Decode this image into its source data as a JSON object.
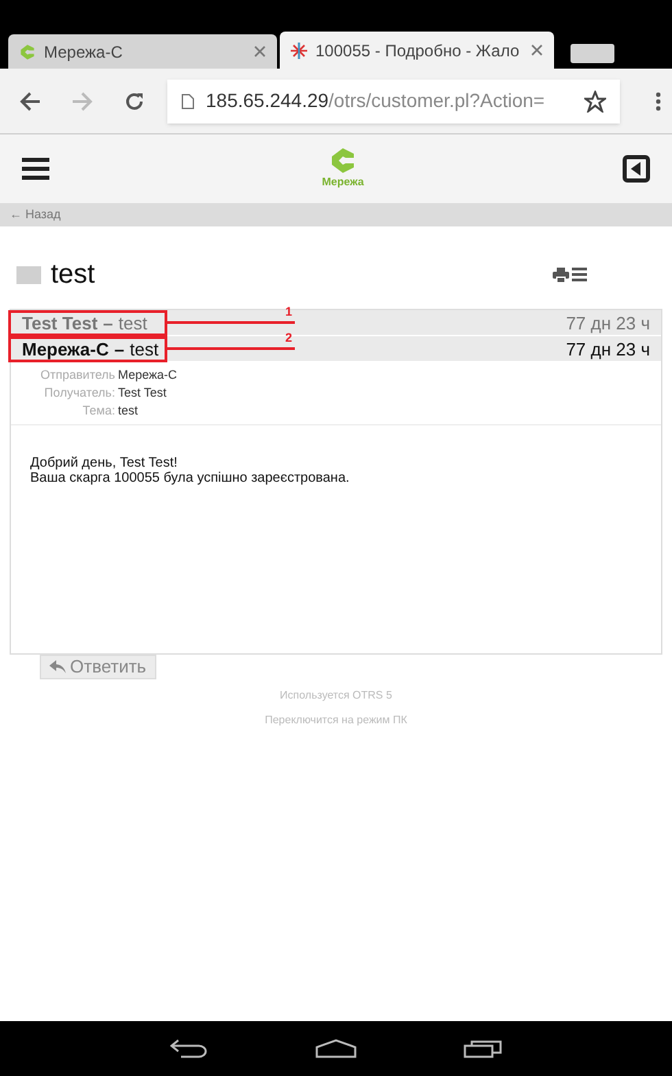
{
  "browser": {
    "tabs": [
      {
        "title": "Мережа-С",
        "selected": false
      },
      {
        "title": "100055 - Подробно - Жало",
        "selected": true
      }
    ],
    "url_host": "185.65.244.29",
    "url_path": "/otrs/customer.pl?Action="
  },
  "header": {
    "logo_text": "Мережа"
  },
  "back_link": "← Назад",
  "ticket": {
    "title": "test",
    "articles": [
      {
        "from": "Test Test",
        "separator": "–",
        "subject": "test",
        "age": "77 дн 23 ч",
        "selected": false,
        "annotation": "1"
      },
      {
        "from": "Мережа-С",
        "separator": "–",
        "subject": "test",
        "age": "77 дн 23 ч",
        "selected": true,
        "annotation": "2"
      }
    ],
    "details": [
      {
        "label": "Отправитель",
        "value": "Мережа-С"
      },
      {
        "label": "Получатель:",
        "value": "Test Test"
      },
      {
        "label": "Тема:",
        "value": "test"
      }
    ],
    "body": [
      "Добрий день, Test Test!",
      "Ваша скарга 100055 була успішно зареєстрована."
    ],
    "reply_button": "Ответить"
  },
  "footer": [
    "Используется OTRS 5",
    "Переключится на режим ПК"
  ]
}
